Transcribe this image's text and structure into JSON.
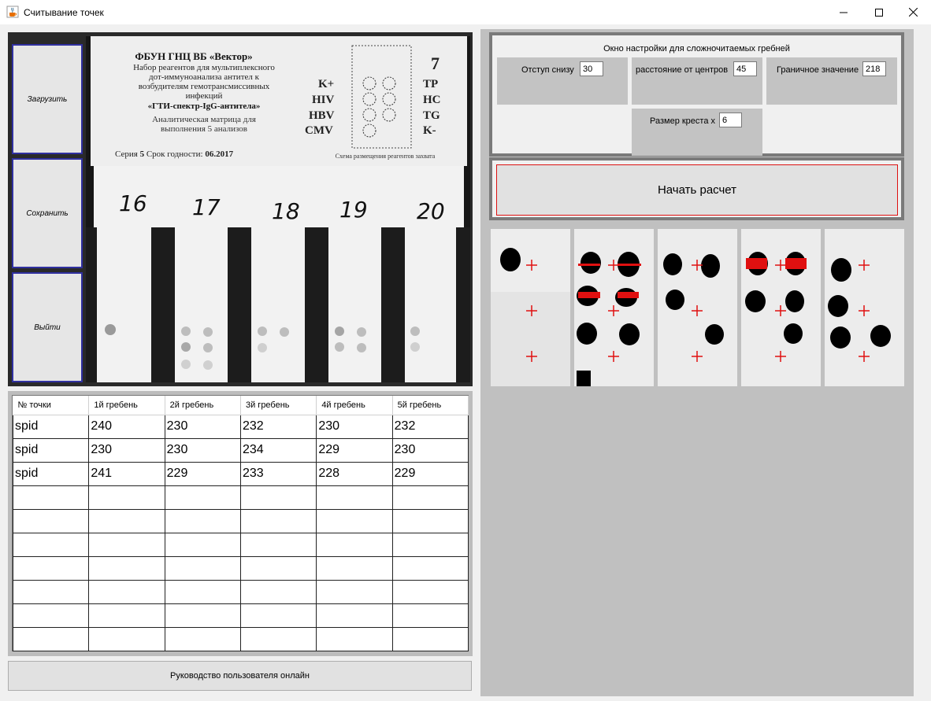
{
  "window": {
    "title": "Считывание точек",
    "icon": "java-cup-icon",
    "controls": [
      "minimize",
      "maximize",
      "close"
    ]
  },
  "sidebar": {
    "load_label": "Загрузить",
    "save_label": "Сохранить",
    "exit_label": "Выйти"
  },
  "photo": {
    "header_line1": "ФБУН ГНЦ ВБ «Вектор»",
    "header_line2": "Набор реагентов для мультиплексного",
    "header_line3": "дот-иммуноанализа антител к",
    "header_line4": "возбудителям гемотрансмиссивных",
    "header_line5": "инфекций",
    "header_line6": "«ГТИ-спектр-IgG-антитела»",
    "header_line7": "Аналитическая матрица для",
    "header_line8": "выполнения 5 анализов",
    "series_label": "Серия",
    "series_value": "5",
    "expiry_label": "Срок годности:",
    "expiry_value": "06.2017",
    "scheme_caption": "Схема размещения реагентов захвата",
    "left_markers": [
      "K+",
      "HIV",
      "HBV",
      "CMV"
    ],
    "right_markers": [
      "TP",
      "HC",
      "TG",
      "K-"
    ],
    "corner_number": "7",
    "strip_numbers": [
      "16",
      "17",
      "18",
      "19",
      "20"
    ]
  },
  "table": {
    "headers": [
      "№ точки",
      "1й гребень",
      "2й гребень",
      "3й гребень",
      "4й гребень",
      "5й гребень"
    ],
    "rows": [
      [
        "spid",
        "240",
        "230",
        "232",
        "230",
        "232"
      ],
      [
        "spid",
        "230",
        "230",
        "234",
        "229",
        "230"
      ],
      [
        "spid",
        "241",
        "229",
        "233",
        "228",
        "229"
      ],
      [
        "",
        "",
        "",
        "",
        "",
        ""
      ],
      [
        "",
        "",
        "",
        "",
        "",
        ""
      ],
      [
        "",
        "",
        "",
        "",
        "",
        ""
      ],
      [
        "",
        "",
        "",
        "",
        "",
        ""
      ],
      [
        "",
        "",
        "",
        "",
        "",
        ""
      ],
      [
        "",
        "",
        "",
        "",
        "",
        ""
      ],
      [
        "",
        "",
        "",
        "",
        "",
        ""
      ]
    ]
  },
  "manual_button": "Руководство пользователя онлайн",
  "settings": {
    "title": "Окно настройки для сложночитаемых гребней",
    "offset_label": "Отступ снизу",
    "offset_value": "30",
    "distance_label": "расстояние от центров",
    "distance_value": "45",
    "threshold_label": "Граничное значение",
    "threshold_value": "218",
    "cross_label": "Размер креста х",
    "cross_value": "6"
  },
  "start_button": "Начать расчет",
  "colors": {
    "accent_border": "#dd1111",
    "button_border": "#3030a0",
    "cross_red": "#e01010"
  }
}
